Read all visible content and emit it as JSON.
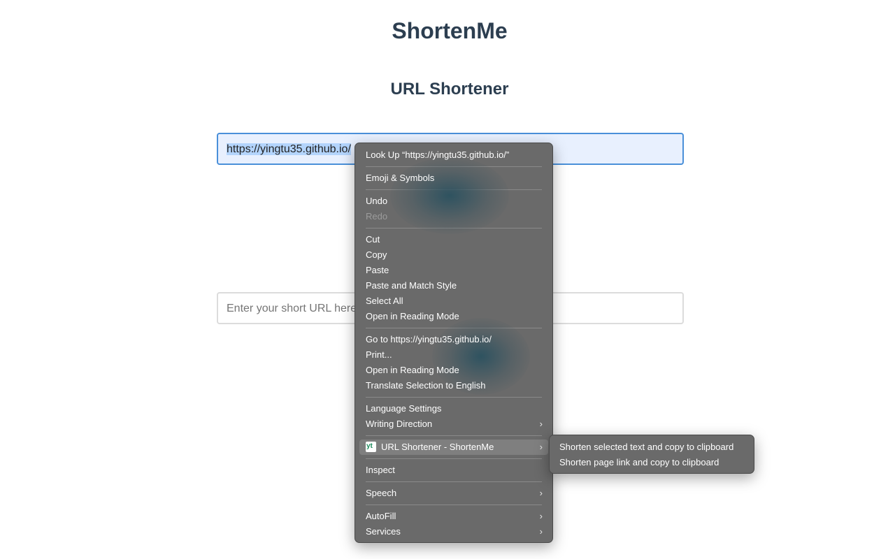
{
  "app": {
    "title": "ShortenMe",
    "section_title": "URL Shortener"
  },
  "long_url_input": {
    "value": "https://yingtu35.github.io/"
  },
  "short_url_input": {
    "placeholder": "Enter your short URL here"
  },
  "context_menu": {
    "items": [
      {
        "label": "Look Up “https://yingtu35.github.io/”"
      },
      {
        "label": "Emoji & Symbols"
      },
      {
        "label": "Undo"
      },
      {
        "label": "Redo",
        "disabled": true
      },
      {
        "label": "Cut"
      },
      {
        "label": "Copy"
      },
      {
        "label": "Paste"
      },
      {
        "label": "Paste and Match Style"
      },
      {
        "label": "Select All"
      },
      {
        "label": "Open in Reading Mode"
      },
      {
        "label": "Go to https://yingtu35.github.io/"
      },
      {
        "label": "Print..."
      },
      {
        "label": "Open in Reading Mode"
      },
      {
        "label": "Translate Selection to English"
      },
      {
        "label": "Language Settings"
      },
      {
        "label": "Writing Direction"
      },
      {
        "label": "URL Shortener - ShortenMe",
        "icon_text": "yt"
      },
      {
        "label": "Inspect"
      },
      {
        "label": "Speech"
      },
      {
        "label": "AutoFill"
      },
      {
        "label": "Services"
      }
    ]
  },
  "submenu": {
    "items": [
      {
        "label": "Shorten selected text and copy to clipboard"
      },
      {
        "label": "Shorten page link and copy to clipboard"
      }
    ]
  },
  "icons": {
    "chevron": "chevron-right-icon",
    "extension": "shortenme-extension-icon"
  },
  "colors": {
    "title": "#2c3e50",
    "input_focus_border": "#4a90d9",
    "menu_bg": "#6a6a6a",
    "menu_highlight": "#7f7f7f"
  }
}
